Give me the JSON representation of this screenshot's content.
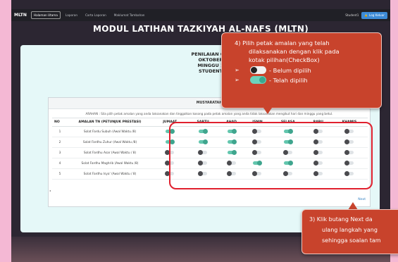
{
  "navbar": {
    "brand": "MLTN",
    "links": [
      "Halaman Utama",
      "Laporan",
      "Carta Laporan",
      "Maklumat Tambahan"
    ],
    "user": "Student1",
    "logout": "Log Keluar"
  },
  "page_title": "MODUL LATIHAN TAZKIYAH AL-NAFS (MLTN)",
  "assessment": {
    "line1": "PENILAIAN 001",
    "line2": "OKTOBER",
    "line3": "MINGGU 1",
    "line4": "STUDENT"
  },
  "panel": {
    "title": "MUSYARATAH",
    "instruction": "ARAHAN : Sila pilih petak amalan yang anda laksanakan dan tinggalkan kosong pada petak amalan yang anda tidak laksanakan mengikut hari dan minggu yang betul."
  },
  "table": {
    "headers": [
      "NO",
      "AMALAN TN (PETUNJUK PRESTASI)",
      "JUMAAT",
      "SABTU",
      "AHAD",
      "ISNIN",
      "SELASA",
      "RABU",
      "KHAMIS"
    ],
    "rows": [
      {
        "no": "1",
        "amalan": "Solat Fardu Subuh (Awal Waktu /8)",
        "checks": [
          true,
          true,
          true,
          false,
          true,
          false,
          false
        ]
      },
      {
        "no": "2",
        "amalan": "Solat Fardhu Zuhur (Awal Waktu /8)",
        "checks": [
          true,
          true,
          true,
          false,
          true,
          false,
          false
        ]
      },
      {
        "no": "3",
        "amalan": "Solat Fardhu Asar (Awal Waktu / 8)",
        "checks": [
          false,
          false,
          true,
          false,
          false,
          false,
          false
        ]
      },
      {
        "no": "4",
        "amalan": "Solat Fardhu Maghrib (Awal Waktu /8)",
        "checks": [
          false,
          false,
          false,
          true,
          true,
          false,
          false
        ]
      },
      {
        "no": "5",
        "amalan": "Solat Fardhu Isya' (Awal Waktu / 8)",
        "checks": [
          false,
          false,
          false,
          false,
          false,
          false,
          false
        ]
      }
    ]
  },
  "next_label": "Next",
  "scroll_marker": "◂",
  "callout_top": {
    "line1": "4)   Pilih petak amalan yang telah",
    "line2": "dilaksanakan dengan klik pada",
    "line3": "kotak pilihan(CheckBox)",
    "bullet1": "- Belum dipilih",
    "bullet2": "- Telah dipilih",
    "arrow": "➢"
  },
  "callout_bottom": {
    "line1": "3)  Klik butang Next da",
    "line2": "ulang langkah yang",
    "line3": "sehingga soalan tam"
  },
  "colors": {
    "toggle_on": "#63c6ae",
    "toggle_off": "#dfe3e6",
    "callout": "#c8432c",
    "highlight": "#e0202e",
    "background": "#f4b8d4"
  }
}
